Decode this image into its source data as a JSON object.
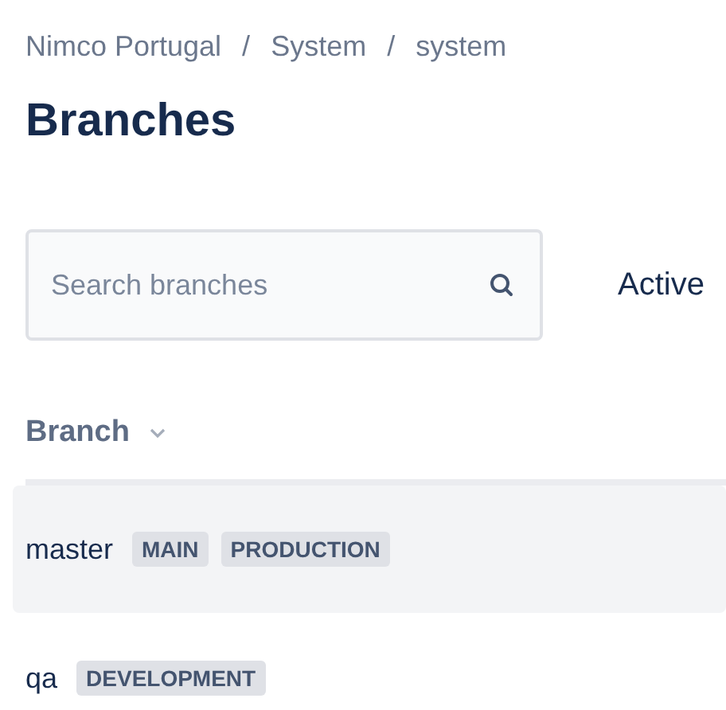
{
  "breadcrumbs": [
    "Nimco Portugal",
    "System",
    "system"
  ],
  "breadcrumb_separator": "/",
  "title": "Branches",
  "search": {
    "placeholder": "Search branches"
  },
  "filter": {
    "label": "Active"
  },
  "table": {
    "columns": [
      {
        "label": "Branch",
        "sortable": true
      }
    ],
    "rows": [
      {
        "name": "master",
        "selected": true,
        "tags": [
          "MAIN",
          "PRODUCTION"
        ]
      },
      {
        "name": "qa",
        "selected": false,
        "tags": [
          "DEVELOPMENT"
        ]
      }
    ]
  }
}
